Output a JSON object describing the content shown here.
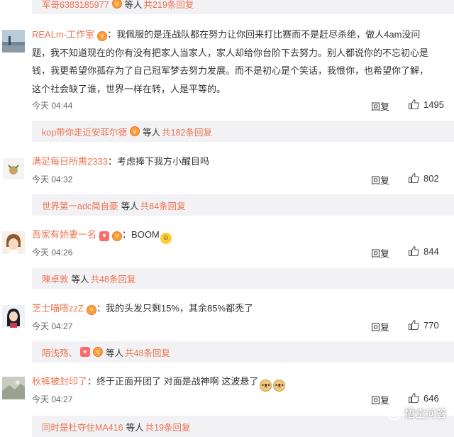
{
  "top_reply": {
    "user": "军哥6383185977",
    "mid": "等人",
    "count": "共219条回复"
  },
  "comments": [
    {
      "user": "REALm-工作室",
      "sep": "：",
      "lines": [
        "我佩服的是连战队都在努力让你回来打比赛而不是赶尽杀绝，做人4am没问",
        "题，我不知道现在的你有没有把家人当家人，家人却给你台阶下去努力。别人都说你的不忘初心是",
        "钱，我更希望你孤存为了自己冠军梦去努力发展。而不是初心是个笑话，我恨你，也希望你了解，",
        "这个社会缺了谁，世界一样在转，人是平等的。"
      ],
      "time": "今天 04:44",
      "reply_label": "回复",
      "likes": "1495",
      "reply_bar": {
        "user": "kop带你走近安菲尔德",
        "mid": "等人",
        "count": "共182条回复"
      }
    },
    {
      "user": "满足每日所需2333",
      "sep": "：",
      "lines": [
        "考虑捧下我方小醒目吗"
      ],
      "time": "今天 04:32",
      "reply_label": "回复",
      "likes": "802",
      "reply_bar": {
        "user": "世界第一adc简自豪",
        "mid": "等人",
        "count": "共84条回复"
      }
    },
    {
      "user": "吾家有娇妻一名",
      "sep": "：",
      "lines": [
        "BOOM"
      ],
      "time": "今天 04:26",
      "reply_label": "回复",
      "likes": "844",
      "reply_bar": {
        "user": "陳卓敦",
        "mid": "等人",
        "count": "共48条回复"
      }
    },
    {
      "user": "芝士喵唔zzZ",
      "sep": "：",
      "lines": [
        "我的头发只剩15%，其余85%都秃了"
      ],
      "time": "今天 04:27",
      "reply_label": "回复",
      "likes": "770",
      "reply_bar": {
        "user": "陌浅殇、",
        "mid": "等人",
        "count": "共48条回复"
      }
    },
    {
      "user": "秋裤被封印了",
      "sep": "：",
      "lines": [
        "终于正面开团了 对面是战神啊 这波悬了"
      ],
      "time": "今天 04:27",
      "reply_label": "回复",
      "likes": "646",
      "reply_bar": {
        "user": "同时是杜夺住MA416",
        "mid": "等人",
        "count": "共19条回复"
      }
    }
  ],
  "watermark": "悟空问答",
  "colors": {
    "link": "#eb7350",
    "reply_bg": "#f2f2f5",
    "text": "#333333",
    "muted": "#666666"
  }
}
